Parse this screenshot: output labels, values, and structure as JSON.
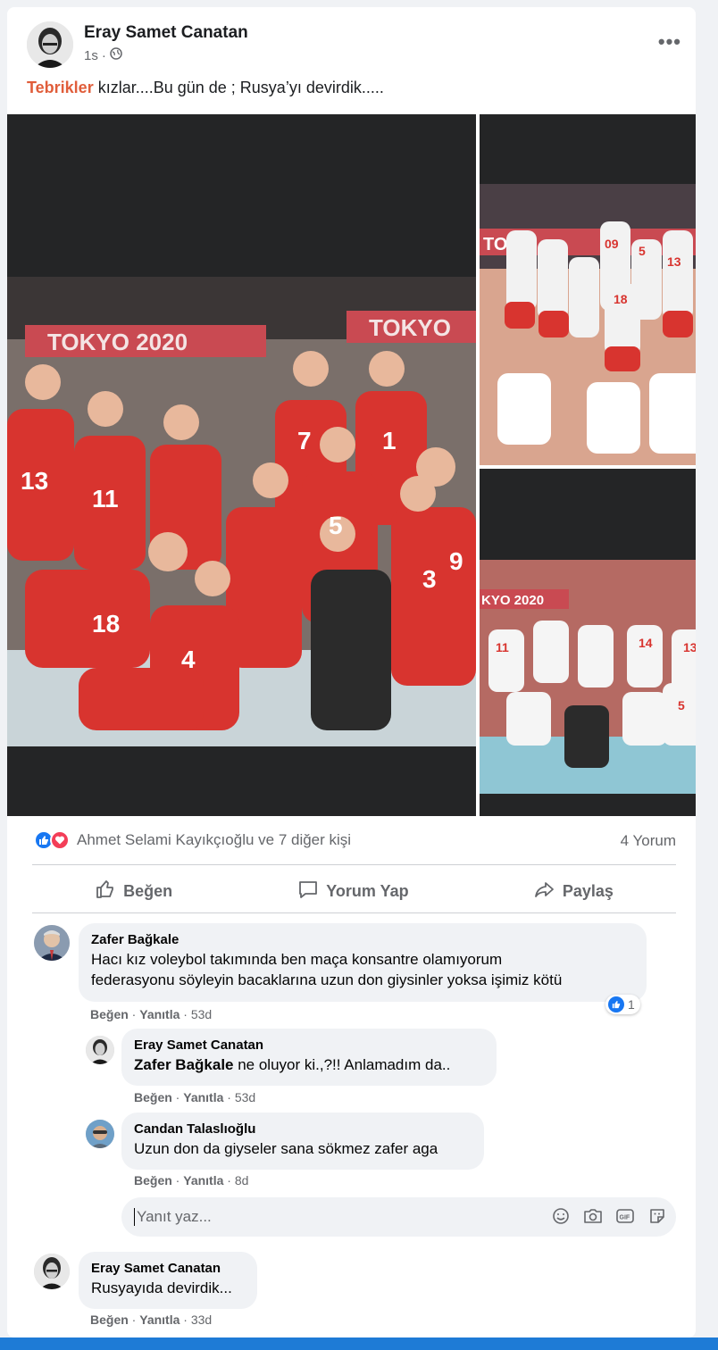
{
  "post": {
    "author": "Eray Samet Canatan",
    "time": "1s",
    "text_highlight": "Tebrikler",
    "text_rest": " kızlar....Bu gün de ; Rusya’yı devirdik.....",
    "photos": {
      "main_banner": "TOKYO 2020",
      "main_banner_right": "TOKYO",
      "jersey_numbers_main": [
        "13",
        "11",
        "7",
        "1",
        "18",
        "4",
        "5",
        "3",
        "9"
      ],
      "top_right_banner": "TO",
      "top_right_numbers": [
        "09",
        "5",
        "13",
        "18"
      ],
      "bottom_right_banner": "KYO 2020",
      "bottom_right_numbers": [
        "11",
        "14",
        "13",
        "5"
      ]
    }
  },
  "reactions": {
    "summary": "Ahmet Selami Kayıkçıoğlu ve 7 diğer kişi",
    "comment_count": "4 Yorum"
  },
  "actions": {
    "like": "Beğen",
    "comment": "Yorum Yap",
    "share": "Paylaş"
  },
  "comments": [
    {
      "name": "Zafer Bağkale",
      "line1": "Hacı kız voleybol takımında ben maça konsantre olamıyorum",
      "line2": "federasyonu söyleyin bacaklarına uzun don giysinler yoksa işimiz kötü",
      "like": "Beğen",
      "reply": "Yanıtla",
      "time": "53d",
      "likes": "1"
    },
    {
      "name": "Eray Samet Canatan",
      "mention": "Zafer Bağkale",
      "text": " ne oluyor ki.,?!! Anlamadım da..",
      "like": "Beğen",
      "reply": "Yanıtla",
      "time": "53d"
    },
    {
      "name": "Candan Talaslıoğlu",
      "text": "Uzun don da giyseler sana sökmez zafer aga",
      "like": "Beğen",
      "reply": "Yanıtla",
      "time": "8d"
    },
    {
      "name": "Eray Samet Canatan",
      "text": "Rusyayıda devirdik...",
      "like": "Beğen",
      "reply": "Yanıtla",
      "time": "33d"
    }
  ],
  "reply_box": {
    "placeholder": "Yanıt yaz..."
  },
  "separator": " · "
}
